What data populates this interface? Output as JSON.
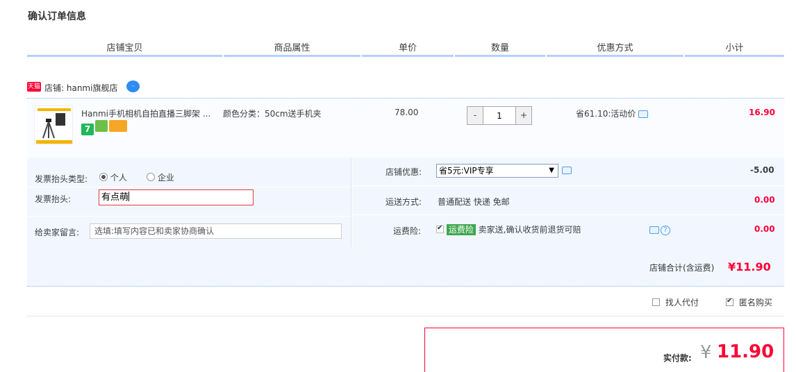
{
  "page_title": "确认订单信息",
  "columns": [
    "店铺宝贝",
    "商品属性",
    "单价",
    "数量",
    "优惠方式",
    "小计"
  ],
  "shop": {
    "badge": "天猫",
    "label": "店铺: hanmi旗舰店"
  },
  "item": {
    "title": "Hanmi手机相机自拍直播三脚架 ...",
    "attribute": "颜色分类：50cm送手机夹",
    "unit_price": "78.00",
    "quantity": "1",
    "qty_minus": "-",
    "qty_plus": "+",
    "discount": "省61.10:活动价",
    "subtotal": "16.90",
    "service_badge_7": "7"
  },
  "invoice": {
    "type_label": "发票抬头类型:",
    "option_personal": "个人",
    "option_company": "企业",
    "title_label": "发票抬头:",
    "title_value": "有点萌"
  },
  "message": {
    "label": "给卖家留言:",
    "placeholder": "选填:填写内容已和卖家协商确认"
  },
  "shop_discount": {
    "label": "店铺优惠:",
    "selected": "省5元:VIP专享",
    "amount": "-5.00"
  },
  "shipping": {
    "label": "运送方式:",
    "value": "普通配送 快递 免邮",
    "amount": "0.00"
  },
  "insurance": {
    "label": "运费险:",
    "badge": "运费险",
    "text": "卖家送,确认收货前退货可赔",
    "amount": "0.00",
    "help": "?"
  },
  "shop_total": {
    "label": "店铺合计(含运费)",
    "value": "¥11.90"
  },
  "extras": {
    "proxy_pay": "找人代付",
    "anonymous": "匿名购买"
  },
  "final": {
    "label": "实付款:",
    "currency": "¥",
    "value": "11.90"
  },
  "colors": {
    "accent_red": "#ff0036",
    "header_rule": "#b2d1ff",
    "panel_bg": "#f2f7ff"
  }
}
